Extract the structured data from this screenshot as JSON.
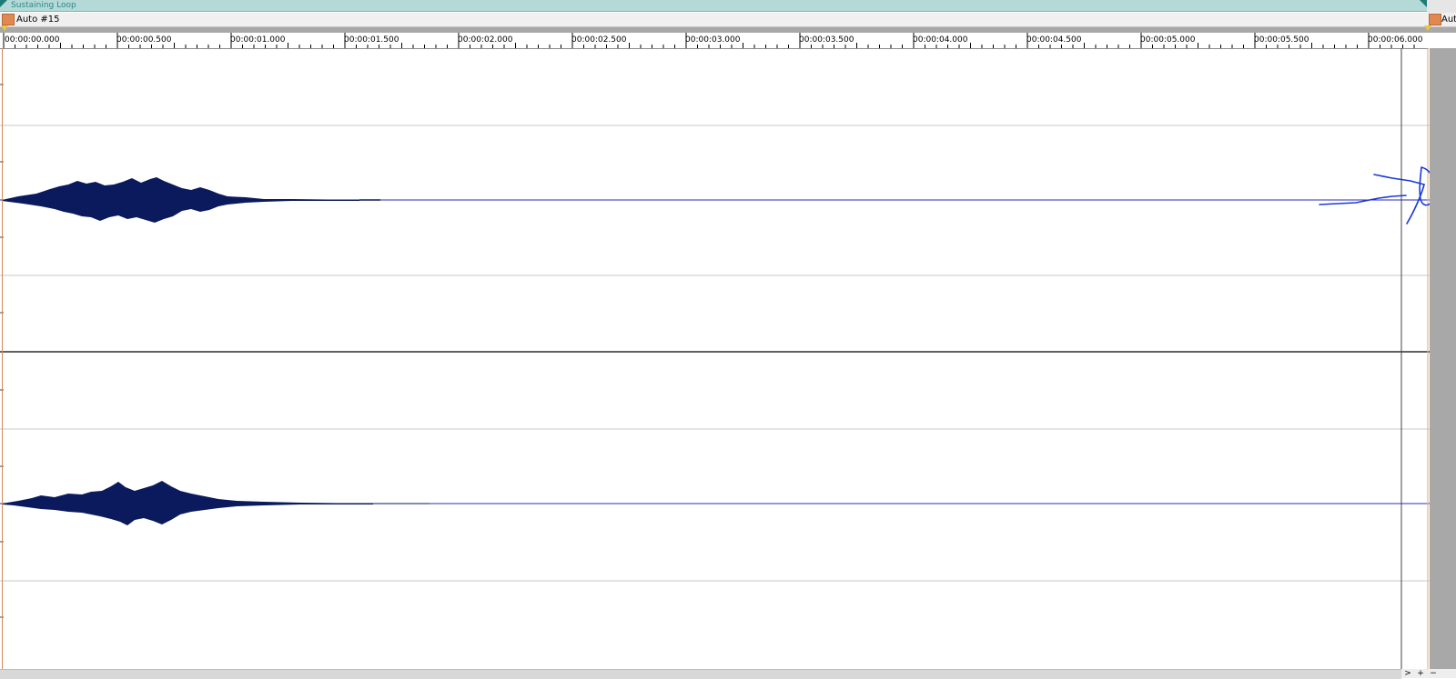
{
  "loop_region": {
    "label": "Sustaining Loop",
    "color": "#b4d9d6"
  },
  "markers": [
    {
      "label": "Auto #15"
    },
    {
      "label": "Aut"
    }
  ],
  "ruler": {
    "ticks": [
      "00:00:00.000",
      "00:00:00.500",
      "00:00:01.000",
      "00:00:01.500",
      "00:00:02.000",
      "00:00:02.500",
      "00:00:03.000",
      "00:00:03.500",
      "00:00:04.000",
      "00:00:04.500",
      "00:00:05.000",
      "00:00:05.500",
      "00:00:06.000"
    ]
  },
  "bottom_controls": {
    "scroll_right": ">",
    "zoom_in": "+",
    "zoom_out": "−"
  },
  "colors": {
    "waveform": "#0a1a5c",
    "centerline": "#2b2bbf",
    "annotation": "#1a3ad8"
  }
}
